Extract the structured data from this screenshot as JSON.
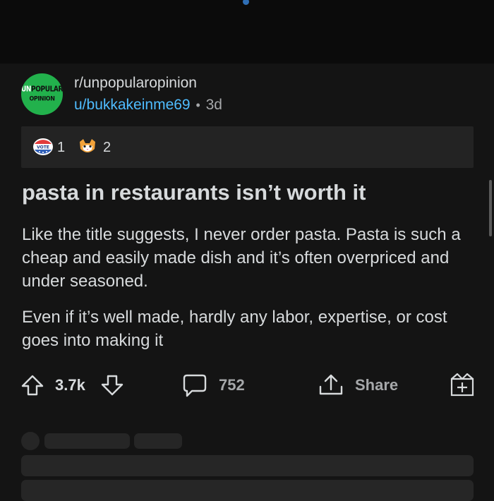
{
  "subreddit": "r/unpopularopinion",
  "avatar": {
    "line1_u": "UN",
    "line1_rest": "POPULAR",
    "line2": "OPINION",
    "color": "#22b14c"
  },
  "author": "u/bukkakeinme69",
  "separator": "•",
  "age": "3d",
  "awards": [
    {
      "icon": "vote-award-icon",
      "count": "1"
    },
    {
      "icon": "cat-award-icon",
      "count": "2"
    }
  ],
  "post": {
    "title": "pasta in restaurants isn’t worth it",
    "paragraphs": [
      "Like the title suggests, I never order pasta.  Pasta is such a cheap and easily made dish and it’s often overpriced and under seasoned.",
      "Even if it’s well made, hardly any labor, expertise, or cost goes into making it"
    ]
  },
  "actions": {
    "score": "3.7k",
    "comments": "752",
    "share": "Share"
  },
  "colors": {
    "accent_link": "#4fbcff",
    "background": "#141414",
    "header": "#0b0b0b"
  }
}
